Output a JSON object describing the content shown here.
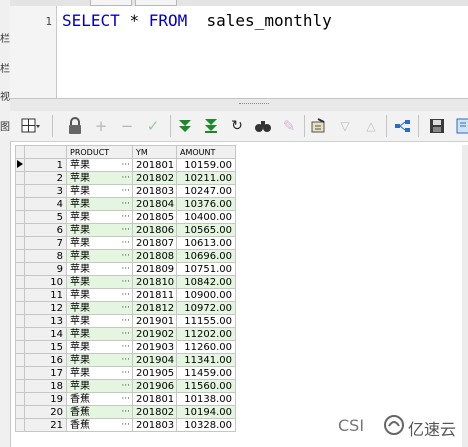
{
  "editor": {
    "line_number": "1",
    "sql": {
      "select": "SELECT",
      "star": "*",
      "from": "FROM",
      "table": "sales_monthly"
    }
  },
  "toolbar": {
    "icons": [
      "grid-menu-icon",
      "lock-icon",
      "add-record-icon",
      "delete-record-icon",
      "post-changes-icon",
      "fetch-next-icon",
      "fetch-last-icon",
      "refresh-icon",
      "find-icon",
      "clear-icon",
      "query-by-example-icon",
      "filter-down-icon",
      "filter-up-icon",
      "export-icon",
      "save-icon",
      "more-icon"
    ]
  },
  "grid": {
    "columns": [
      "PRODUCT",
      "YM",
      "AMOUNT"
    ],
    "rows": [
      {
        "n": "1",
        "product": "苹果",
        "ym": "201801",
        "amount": "10159.00"
      },
      {
        "n": "2",
        "product": "苹果",
        "ym": "201802",
        "amount": "10211.00"
      },
      {
        "n": "3",
        "product": "苹果",
        "ym": "201803",
        "amount": "10247.00"
      },
      {
        "n": "4",
        "product": "苹果",
        "ym": "201804",
        "amount": "10376.00"
      },
      {
        "n": "5",
        "product": "苹果",
        "ym": "201805",
        "amount": "10400.00"
      },
      {
        "n": "6",
        "product": "苹果",
        "ym": "201806",
        "amount": "10565.00"
      },
      {
        "n": "7",
        "product": "苹果",
        "ym": "201807",
        "amount": "10613.00"
      },
      {
        "n": "8",
        "product": "苹果",
        "ym": "201808",
        "amount": "10696.00"
      },
      {
        "n": "9",
        "product": "苹果",
        "ym": "201809",
        "amount": "10751.00"
      },
      {
        "n": "10",
        "product": "苹果",
        "ym": "201810",
        "amount": "10842.00"
      },
      {
        "n": "11",
        "product": "苹果",
        "ym": "201811",
        "amount": "10900.00"
      },
      {
        "n": "12",
        "product": "苹果",
        "ym": "201812",
        "amount": "10972.00"
      },
      {
        "n": "13",
        "product": "苹果",
        "ym": "201901",
        "amount": "11155.00"
      },
      {
        "n": "14",
        "product": "苹果",
        "ym": "201902",
        "amount": "11202.00"
      },
      {
        "n": "15",
        "product": "苹果",
        "ym": "201903",
        "amount": "11260.00"
      },
      {
        "n": "16",
        "product": "苹果",
        "ym": "201904",
        "amount": "11341.00"
      },
      {
        "n": "17",
        "product": "苹果",
        "ym": "201905",
        "amount": "11459.00"
      },
      {
        "n": "18",
        "product": "苹果",
        "ym": "201906",
        "amount": "11560.00"
      },
      {
        "n": "19",
        "product": "香蕉",
        "ym": "201801",
        "amount": "10138.00"
      },
      {
        "n": "20",
        "product": "香蕉",
        "ym": "201802",
        "amount": "10194.00"
      },
      {
        "n": "21",
        "product": "香蕉",
        "ym": "201803",
        "amount": "10328.00"
      }
    ]
  },
  "watermark": {
    "prefix": "CSI",
    "brand": "亿速云"
  }
}
